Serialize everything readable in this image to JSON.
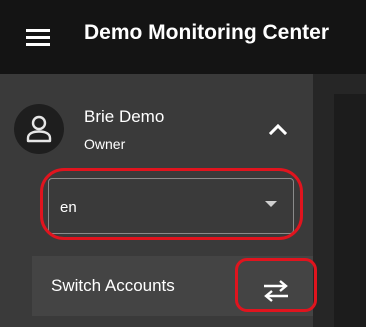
{
  "appbar": {
    "title": "Demo Monitoring Center",
    "menu_icon": "hamburger-menu-icon"
  },
  "drawer": {
    "user": {
      "name": "Brie Demo",
      "role": "Owner",
      "avatar_icon": "person-icon",
      "collapse_icon": "chevron-up-icon"
    },
    "language_select": {
      "value": "en",
      "dropdown_icon": "caret-down-icon"
    },
    "switch_accounts": {
      "label": "Switch Accounts",
      "icon": "swap-arrows-icon"
    }
  },
  "annotations": {
    "color": "#e0141e",
    "highlighted": [
      "language-select",
      "switch-accounts-button"
    ]
  },
  "colors": {
    "appbar_bg": "#141414",
    "drawer_bg": "#3a3a3a",
    "row_bg": "#444444",
    "text": "#ffffff"
  }
}
